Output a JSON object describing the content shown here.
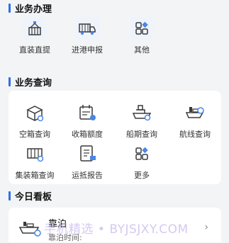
{
  "sections": {
    "business": "业务办理",
    "query": "业务查询",
    "board": "今日看板"
  },
  "business_items": [
    {
      "label": "直装直提",
      "icon": "container-crane-icon"
    },
    {
      "label": "进港申报",
      "icon": "truck-icon"
    },
    {
      "label": "其他",
      "icon": "grid-icon"
    }
  ],
  "query_items": [
    {
      "label": "空箱查询",
      "icon": "empty-box-search-icon"
    },
    {
      "label": "收箱额度",
      "icon": "calendar-quota-icon"
    },
    {
      "label": "船期查询",
      "icon": "ship-schedule-icon"
    },
    {
      "label": "航线查询",
      "icon": "route-ship-icon"
    },
    {
      "label": "集装箱查询",
      "icon": "container-search-icon"
    },
    {
      "label": "运抵报告",
      "icon": "report-icon"
    },
    {
      "label": "更多",
      "icon": "more-grid-icon"
    }
  ],
  "board_item": {
    "title": "靠泊",
    "subtitle": "靠泊时间:",
    "icon": "ship-berth-icon"
  },
  "watermark": "手机精选 • BYJSJXY.COM",
  "colors": {
    "accent": "#2f6fe4",
    "icon": "#3a3a3a",
    "icon_accent": "#4a86e8"
  }
}
